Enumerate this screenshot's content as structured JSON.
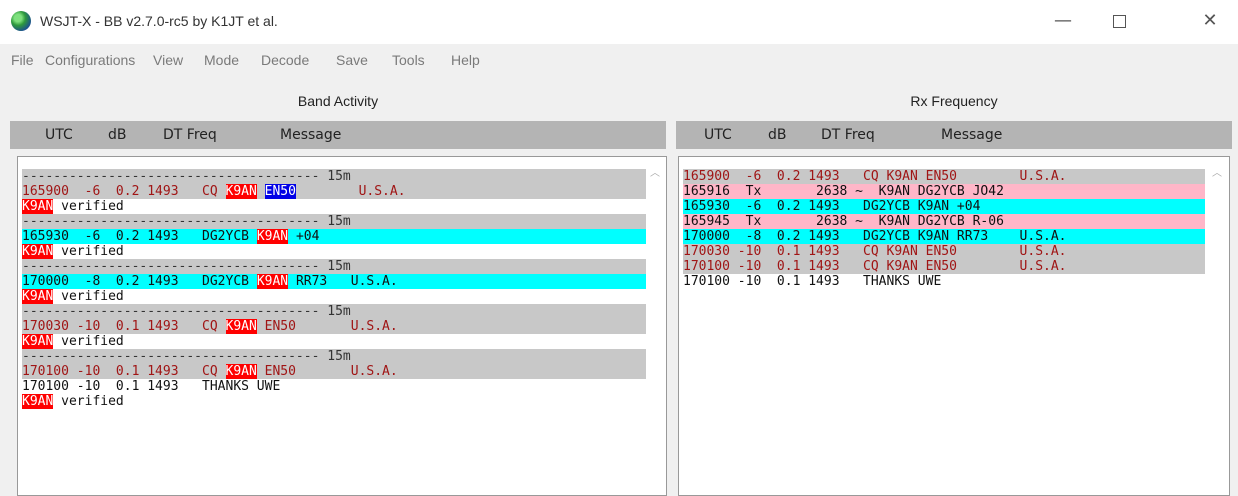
{
  "window": {
    "title": "WSJT-X - BB   v2.7.0-rc5   by K1JT et al.",
    "minimize": "—",
    "close": "✕"
  },
  "menu": [
    "File",
    "Configurations",
    "View",
    "Mode",
    "Decode",
    "Save",
    "Tools",
    "Help"
  ],
  "band_activity": {
    "title": "Band Activity",
    "headers": {
      "utc": "UTC",
      "db": "dB",
      "dt_freq": "DT Freq",
      "message": "Message"
    },
    "lines": [
      {
        "type": "sep",
        "text": "-------------------------------------- 15m"
      },
      {
        "type": "decode",
        "bg": "gray",
        "cols": "165900  -6  0.2 1493   CQ ",
        "call": "K9AN",
        "sp": " ",
        "grid": "EN50",
        "grid_hl": "blue",
        "rest": "        U.S.A."
      },
      {
        "type": "verified",
        "call": "K9AN",
        "rest": " verified"
      },
      {
        "type": "sep",
        "text": "-------------------------------------- 15m"
      },
      {
        "type": "decode",
        "bg": "cyan",
        "cols": "165930  -6  0.2 1493   DG2YCB ",
        "call": "K9AN",
        "sp": " ",
        "grid": "+04",
        "grid_hl": "none",
        "rest": ""
      },
      {
        "type": "verified",
        "call": "K9AN",
        "rest": " verified"
      },
      {
        "type": "sep",
        "text": "-------------------------------------- 15m"
      },
      {
        "type": "decode",
        "bg": "cyan",
        "cols": "170000  -8  0.2 1493   DG2YCB ",
        "call": "K9AN",
        "sp": " ",
        "grid": "RR73",
        "grid_hl": "none",
        "rest": "   U.S.A."
      },
      {
        "type": "verified",
        "call": "K9AN",
        "rest": " verified"
      },
      {
        "type": "sep",
        "text": "-------------------------------------- 15m"
      },
      {
        "type": "decode",
        "bg": "gray",
        "cols": "170030 -10  0.1 1493   CQ ",
        "call": "K9AN",
        "sp": " ",
        "grid": "EN50",
        "grid_hl": "none",
        "rest": "       U.S.A."
      },
      {
        "type": "verified",
        "call": "K9AN",
        "rest": " verified"
      },
      {
        "type": "sep",
        "text": "-------------------------------------- 15m"
      },
      {
        "type": "decode",
        "bg": "gray",
        "cols": "170100 -10  0.1 1493   CQ ",
        "call": "K9AN",
        "sp": " ",
        "grid": "EN50",
        "grid_hl": "none",
        "rest": "       U.S.A."
      },
      {
        "type": "plain",
        "text": "170100 -10  0.1 1493   THANKS UWE"
      },
      {
        "type": "verified",
        "call": "K9AN",
        "rest": " verified"
      }
    ]
  },
  "rx_frequency": {
    "title": "Rx Frequency",
    "headers": {
      "utc": "UTC",
      "db": "dB",
      "dt_freq": "DT Freq",
      "message": "Message"
    },
    "lines": [
      {
        "bg": "gray",
        "color": "red",
        "text": "165900  -6  0.2 1493   CQ K9AN EN50        U.S.A."
      },
      {
        "bg": "pink",
        "color": "black",
        "text": "165916  Tx       2638 ~  K9AN DG2YCB JO42"
      },
      {
        "bg": "cyan",
        "color": "black",
        "text": "165930  -6  0.2 1493   DG2YCB K9AN +04"
      },
      {
        "bg": "pink",
        "color": "black",
        "text": "165945  Tx       2638 ~  K9AN DG2YCB R-06"
      },
      {
        "bg": "cyan",
        "color": "black",
        "text": "170000  -8  0.2 1493   DG2YCB K9AN RR73    U.S.A."
      },
      {
        "bg": "gray",
        "color": "red",
        "text": "170030 -10  0.1 1493   CQ K9AN EN50        U.S.A."
      },
      {
        "bg": "gray",
        "color": "red",
        "text": "170100 -10  0.1 1493   CQ K9AN EN50        U.S.A."
      },
      {
        "bg": "none",
        "color": "black",
        "text": "170100 -10  0.1 1493   THANKS UWE"
      }
    ]
  },
  "colors": {
    "cq_bg": "#c8c8c8",
    "my_call_bg": "#00ffff",
    "tx_bg": "#ffb6c8",
    "highlight_call": "#ff0000",
    "highlight_grid": "#0000e6",
    "decode_text": "#a01515"
  }
}
